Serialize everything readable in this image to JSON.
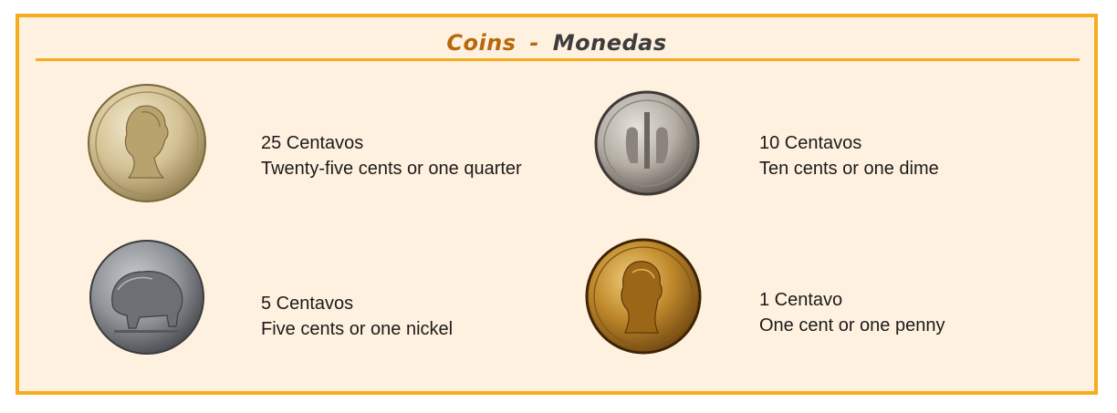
{
  "title": {
    "english": "Coins",
    "separator": "-",
    "spanish": "Monedas"
  },
  "coins": [
    {
      "icon": "quarter-coin-icon",
      "spanish": "25 Centavos",
      "english": "Twenty-five cents or one quarter",
      "color": "#cdb88a"
    },
    {
      "icon": "dime-coin-icon",
      "spanish": "10 Centavos",
      "english": "Ten cents or one dime",
      "color": "#b9b3ab"
    },
    {
      "icon": "nickel-coin-icon",
      "spanish": "5 Centavos",
      "english": "Five cents or one nickel",
      "color": "#8f9297"
    },
    {
      "icon": "penny-coin-icon",
      "spanish": "1 Centavo",
      "english": "One cent or one penny",
      "color": "#b37a1e"
    }
  ],
  "colors": {
    "border": "#f5ad1d",
    "background": "#fff1df",
    "title_english": "#b8680c",
    "title_spanish": "#3d3d3d"
  }
}
